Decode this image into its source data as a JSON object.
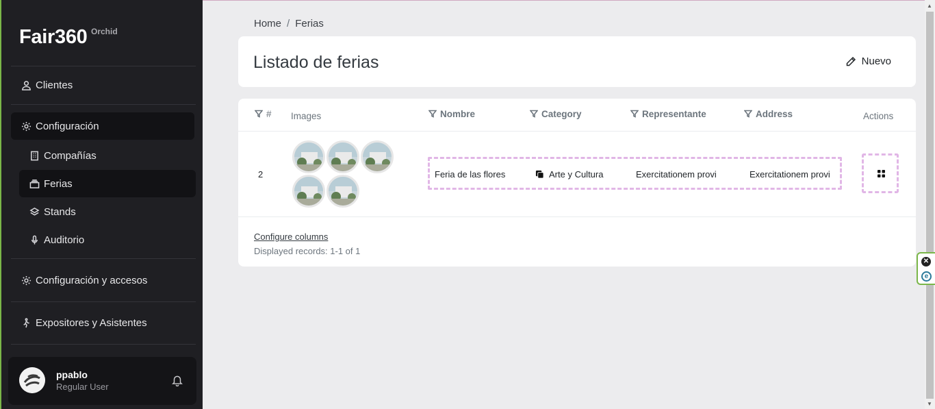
{
  "brand": {
    "name": "Fair360",
    "sub": "Orchid"
  },
  "sidebar": {
    "items": [
      {
        "label": "Clientes",
        "icon": "user-icon"
      },
      {
        "label": "Configuración",
        "icon": "gear-icon"
      },
      {
        "label": "Compañías",
        "icon": "building-icon"
      },
      {
        "label": "Ferias",
        "icon": "stack-icon"
      },
      {
        "label": "Stands",
        "icon": "layers-icon"
      },
      {
        "label": "Auditorio",
        "icon": "microphone-icon"
      },
      {
        "label": "Configuración y accesos",
        "icon": "gear-icon"
      },
      {
        "label": "Expositores y Asistentes",
        "icon": "walking-person-icon"
      }
    ]
  },
  "profile": {
    "name": "ppablo",
    "role": "Regular User"
  },
  "breadcrumb": {
    "home": "Home",
    "sep": "/",
    "current": "Ferias"
  },
  "page": {
    "title": "Listado de ferias",
    "new_label": "Nuevo"
  },
  "table": {
    "headers": {
      "id": "#",
      "images": "Images",
      "name": "Nombre",
      "category": "Category",
      "rep": "Representante",
      "address": "Address",
      "actions": "Actions"
    },
    "rows": [
      {
        "id": "2",
        "name": "Feria de las flores",
        "category": "Arte y Cultura",
        "rep": "Exercitationem provi",
        "address": "Exercitationem provi",
        "image_count": 5
      }
    ],
    "configure_columns": "Configure columns",
    "records": "Displayed records: 1-1 of 1"
  },
  "colors": {
    "sidebar_bg": "#1f1f23",
    "accent_green": "#7ab648",
    "highlight": "#e1b6e6"
  }
}
